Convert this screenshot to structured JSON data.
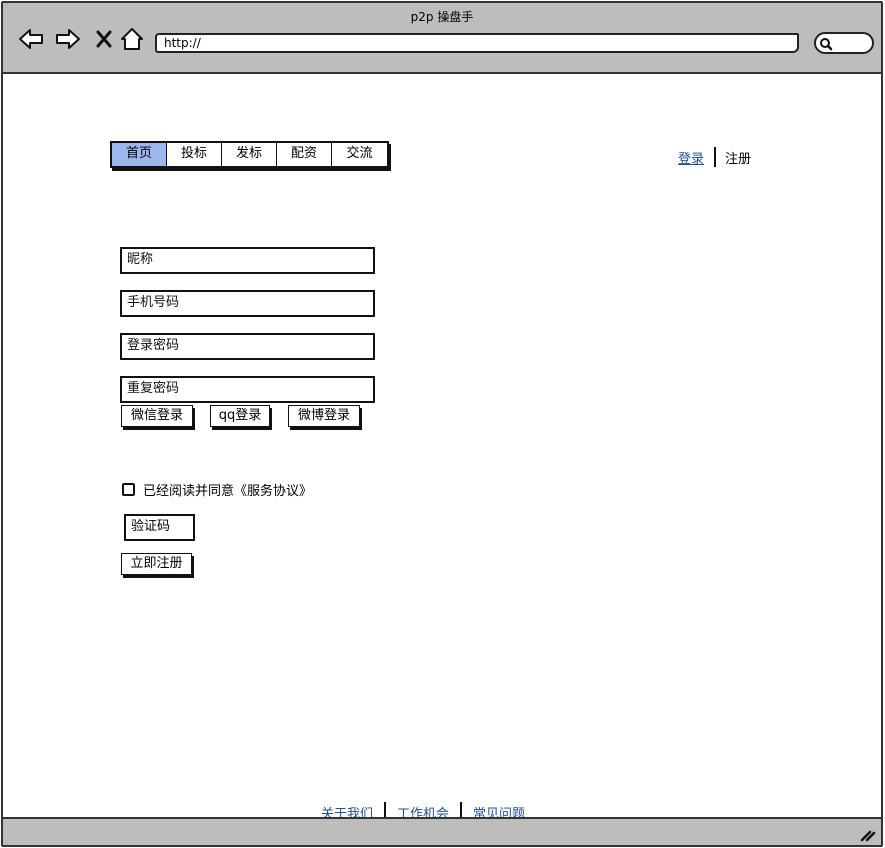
{
  "window": {
    "title": "p2p 操盘手"
  },
  "browser": {
    "url": "http://",
    "icons": [
      "back-arrow-icon",
      "forward-arrow-icon",
      "close-x-icon",
      "home-icon",
      "search-icon",
      "resize-grip-icon"
    ]
  },
  "nav": {
    "tabs": [
      {
        "label": "首页",
        "active": true
      },
      {
        "label": "投标",
        "active": false
      },
      {
        "label": "发标",
        "active": false
      },
      {
        "label": "配资",
        "active": false
      },
      {
        "label": "交流",
        "active": false
      }
    ]
  },
  "auth": {
    "login": "登录",
    "register": "注册"
  },
  "form": {
    "nickname": "昵称",
    "phone": "手机号码",
    "password": "登录密码",
    "confirm_password": "重复密码",
    "wechat_login": "微信登录",
    "qq_login": "qq登录",
    "weibo_login": "微博登录",
    "agree_text": "已经阅读并同意《服务协议》",
    "captcha": "验证码",
    "submit": "立即注册"
  },
  "footer": {
    "about": "关于我们",
    "jobs": "工作机会",
    "faq": "常见问题"
  },
  "colors": {
    "chrome": "#bdbdbd",
    "active_tab": "#9bb7ee",
    "link": "#1f4fa0"
  }
}
